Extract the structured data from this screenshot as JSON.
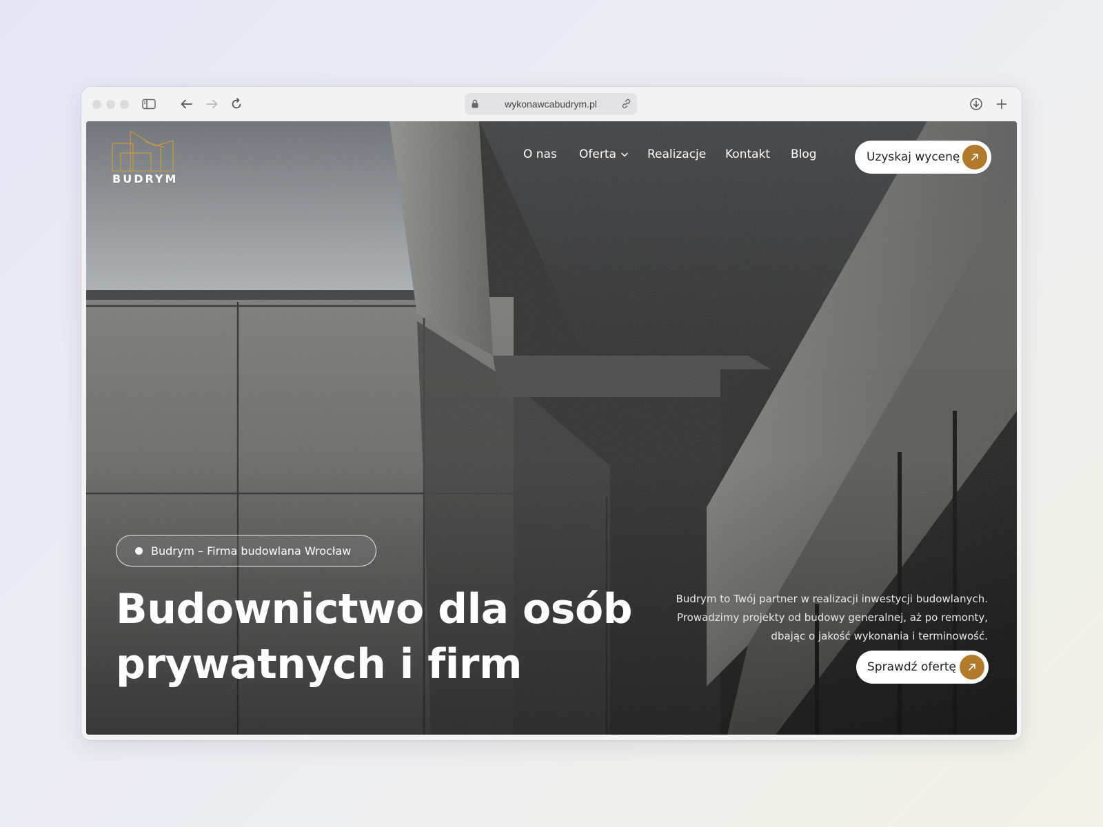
{
  "browser": {
    "url": "wykonawcabudrym.pl"
  },
  "site": {
    "logo_text": "BUDRYM",
    "brand_color": "#b27a2c",
    "nav": {
      "items": [
        {
          "label": "O nas"
        },
        {
          "label": "Oferta"
        },
        {
          "label": "Realizacje"
        },
        {
          "label": "Kontakt"
        },
        {
          "label": "Blog"
        }
      ],
      "cta_label": "Uzyskaj wycenę"
    },
    "hero": {
      "badge": "Budrym – Firma budowlana Wrocław",
      "headline_line1": "Budownictwo dla osób",
      "headline_line2": "prywatnych i firm",
      "description_line1": "Budrym to Twój partner w realizacji inwestycji budowlanych.",
      "description_line2": "Prowadzimy projekty od budowy generalnej, aż po remonty,",
      "description_line3": "dbając o jakość wykonania i terminowość.",
      "cta_label": "Sprawdź ofertę"
    }
  }
}
